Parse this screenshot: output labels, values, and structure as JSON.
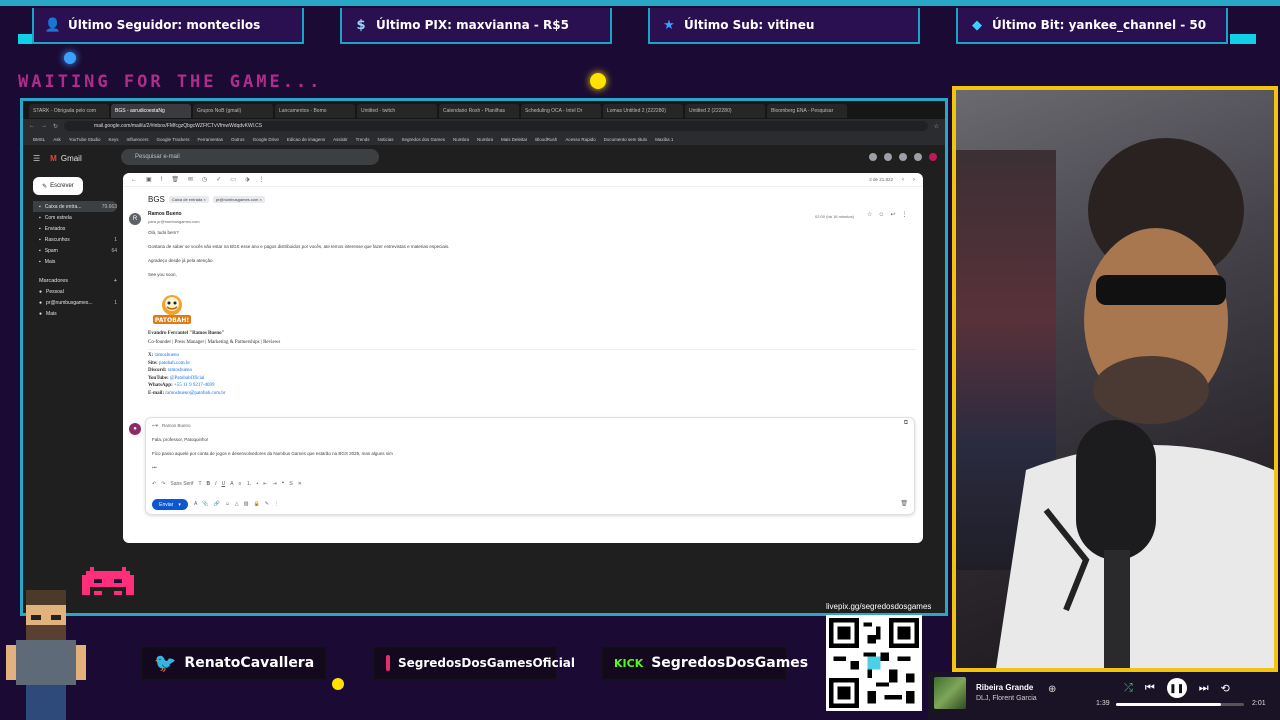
{
  "banners": [
    {
      "icon": "user-icon",
      "text": "Último Seguidor: montecilos"
    },
    {
      "icon": "dollar-icon",
      "text": "Último PIX: maxvianna - R$5"
    },
    {
      "icon": "star-icon",
      "text": "Último Sub: vitineu"
    },
    {
      "icon": "diamond-icon",
      "text": "Último Bit: yankee_channel - 50"
    }
  ],
  "waiting_text": "WAITING FOR THE GAME...",
  "browser": {
    "tabs": [
      "STARK - Obrigada pelo com",
      "BGS - asrudicoestaNg",
      "Grupos NoB (gmail)",
      "Lancamentos - Bomo",
      "Untitled - twitch",
      "Calendario Rosh - Planilhas",
      "Scheduling OCA - Intel Dr",
      "Lomas Untitled 2 (222280)",
      "Untitled 2 (222280)",
      "Bloomberg ENA - Pesquisar"
    ],
    "url": "mail.google.com/mail/u/2/#inbox/FMfcgzQbgcWZFfCTvVfmwWdqdvKWl.CS",
    "bookmarks": [
      "BMSL",
      "Ask",
      "YouTube Studio",
      "Keys",
      "Influencers",
      "Google Trackers",
      "Ferramentas",
      "Outros",
      "Google Drive",
      "Edicao de imagens",
      "Assistir",
      "Trends",
      "Noticias",
      "Segredos dos Games",
      "Numbra",
      "Numbra",
      "Mais Deleitar",
      "BloodRush",
      "Acesso Rapido",
      "Documento sem titulo",
      "Maxiba 1"
    ]
  },
  "gmail": {
    "logo": "Gmail",
    "search_placeholder": "Pesquisar e-mail",
    "compose": "Escrever",
    "sidebar": [
      {
        "label": "Caixa de entra...",
        "count": "79.663",
        "active": true
      },
      {
        "label": "Com estrela",
        "count": ""
      },
      {
        "label": "Enviados",
        "count": ""
      },
      {
        "label": "Rascunhos",
        "count": "1"
      },
      {
        "label": "Spam",
        "count": "64"
      },
      {
        "label": "Mais",
        "count": ""
      }
    ],
    "labels_header": "Marcadores",
    "labels": [
      {
        "label": "Pessoal",
        "count": ""
      },
      {
        "label": "pr@numbusgames...",
        "count": "1"
      },
      {
        "label": "Mais",
        "count": ""
      }
    ],
    "pager": "2 de 21.822",
    "subject": "BGS",
    "chips": [
      "Caixa de entrada ×",
      "pr@numbusgames.com ×"
    ],
    "message": {
      "sender": "Ramos Bueno",
      "sender_email": "para pr@numbusgames.com",
      "time": "02:00 (há 16 minutos)",
      "greeting": "Olá, tudo bem?",
      "body1": "Gostaria de saber se vocês vão estar na BGS esse ano e pagos distribuidos por vocês, ate temos interesse que fazer entrevistas e materias especiais.",
      "body2": "Agradeço desde já pela atenção.",
      "closing": "See you soon,",
      "logo_text": "PATOBAH!",
      "sig_name": "Evandro Ferrantel \"Ramos Bueno\"",
      "sig_role": "Co-founder | Press Manager | Marketing & Partnerships | Reviews",
      "sig_lines": [
        {
          "k": "X:",
          "v": "ramosbueno"
        },
        {
          "k": "Site:",
          "v": "patobah.com.br"
        },
        {
          "k": "Discord:",
          "v": "ramosbueno"
        },
        {
          "k": "YouTube:",
          "v": "@PatobahOficial"
        },
        {
          "k": "WhatsApp:",
          "v": "+55 11 9 9217-4699"
        },
        {
          "k": "E-mail:",
          "v": "ramosbueno@patobah.com.br"
        }
      ]
    },
    "reply": {
      "to": "Ramos Bueno",
      "line1": "Fala, professor, Patoquinho!",
      "line2": "Fico passo aquele por conta de jogos e desenvolvedores da Numbus Games que estarão na BGS 2025, mas alguns sim",
      "send": "Enviar",
      "font": "Sans Serif"
    }
  },
  "socials": [
    {
      "icon": "twitter-icon",
      "text": "RenatoCavallera",
      "color": "#1da1f2"
    },
    {
      "icon": "instagram-icon",
      "text": "SegredosDosGamesOficial",
      "color": "#e1306c"
    },
    {
      "icon": "kick-icon",
      "text": "SegredosDosGames",
      "prefix": "KICK",
      "color": "#53fc18"
    }
  ],
  "qr_label": "livepix.gg/segredosdosgames",
  "player": {
    "song": "Ribeira Grande",
    "artist": "DLJ, Florent Garcia",
    "elapsed": "1:39",
    "total": "2:01",
    "progress": 0.82
  },
  "colors": {
    "accent": "#2aa7c7",
    "cam_border": "#f2c40f",
    "bg": "#1b0a33"
  }
}
